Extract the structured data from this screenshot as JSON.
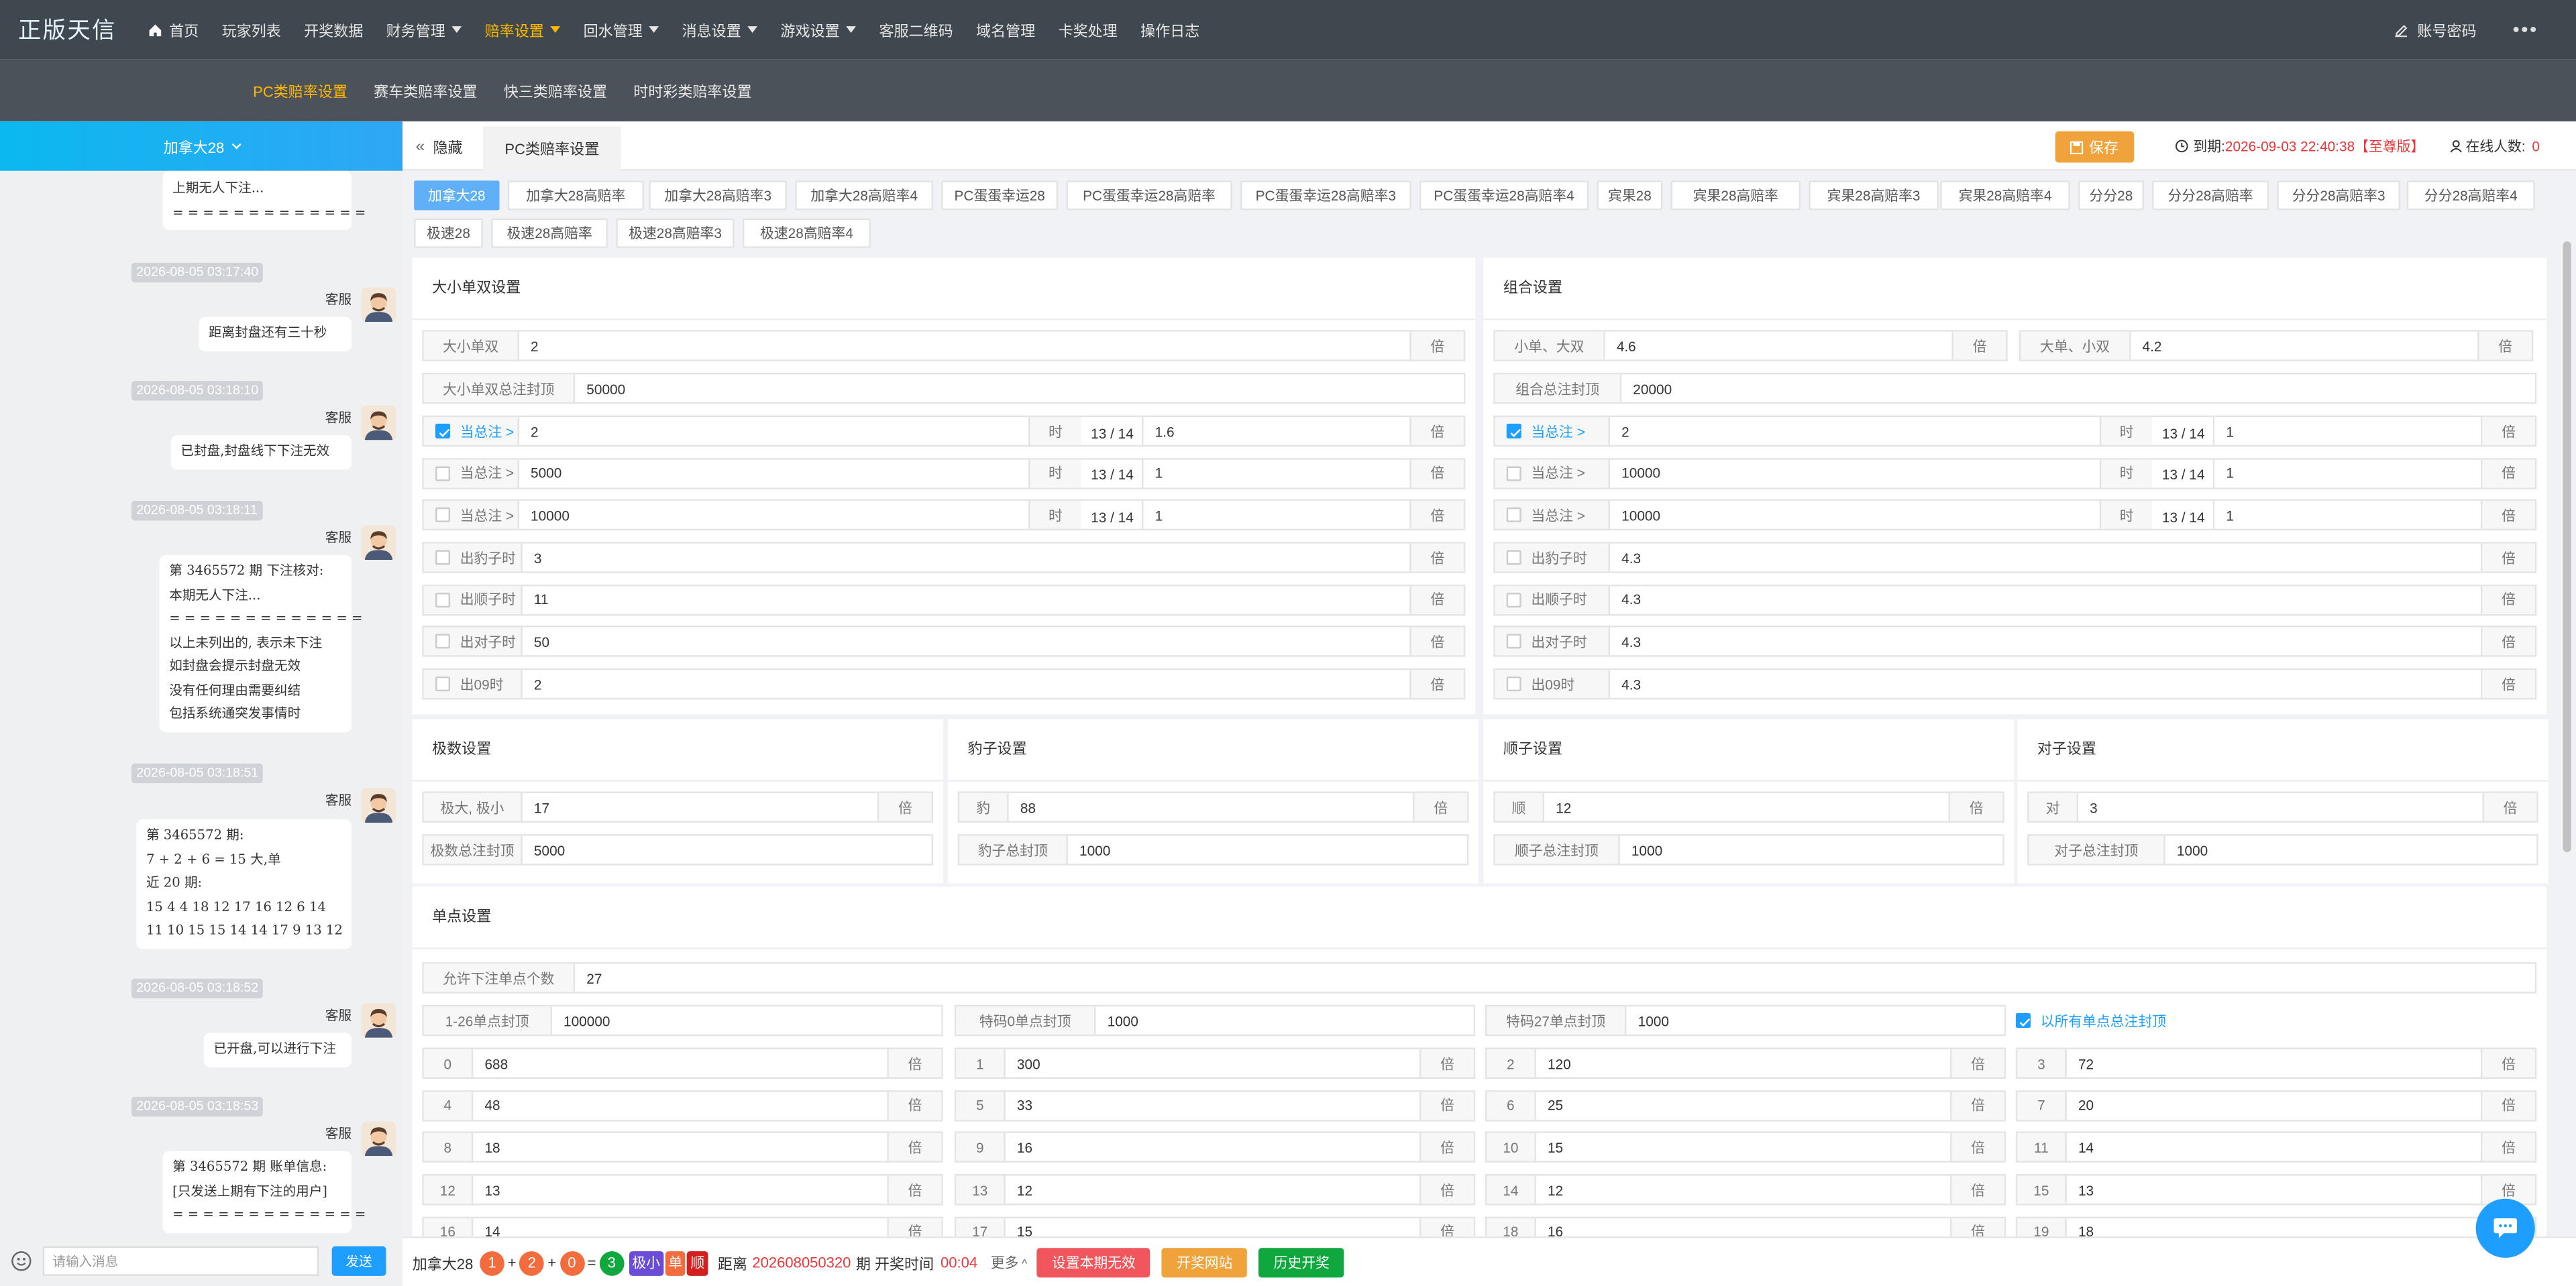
{
  "brand": "正版天信",
  "nav": [
    {
      "label": "首页",
      "icon": "home-icon"
    },
    {
      "label": "玩家列表"
    },
    {
      "label": "开奖数据"
    },
    {
      "label": "财务管理",
      "caret": true
    },
    {
      "label": "赔率设置",
      "caret": true,
      "active": true
    },
    {
      "label": "回水管理",
      "caret": true
    },
    {
      "label": "消息设置",
      "caret": true
    },
    {
      "label": "游戏设置",
      "caret": true
    },
    {
      "label": "客服二维码"
    },
    {
      "label": "域名管理"
    },
    {
      "label": "卡奖处理"
    },
    {
      "label": "操作日志"
    }
  ],
  "account_label": "账号密码",
  "more_label": "•••",
  "subnav": [
    {
      "label": "PC类赔率设置",
      "active": true
    },
    {
      "label": "赛车类赔率设置"
    },
    {
      "label": "快三类赔率设置"
    },
    {
      "label": "时时彩类赔率设置"
    }
  ],
  "chat": {
    "room": "加拿大28",
    "first_bubble": "上期无人下注...\n= = = = = = = = = = = = =",
    "messages": [
      {
        "time": "2026-08-05 03:17:40",
        "user": "客服",
        "text": "距离封盘还有三十秒"
      },
      {
        "time": "2026-08-05 03:18:10",
        "user": "客服",
        "text": "已封盘,封盘线下下注无效"
      },
      {
        "time": "2026-08-05 03:18:11",
        "user": "客服",
        "text": "第 3465572 期 下注核对:\n本期无人下注...\n= = = = = = = = = = = = =\n以上未列出的, 表示未下注\n如封盘会提示封盘无效\n没有任何理由需要纠结\n包括系统通突发事情时"
      },
      {
        "time": "2026-08-05 03:18:51",
        "user": "客服",
        "text": "第 3465572 期:\n7 + 2 + 6 = 15 大,单\n近 20 期:\n15 4 4 18 12 17 16 12 6 14\n11 10 15 15 14 14 17 9 13 12"
      },
      {
        "time": "2026-08-05 03:18:52",
        "user": "客服",
        "text": "已开盘,可以进行下注"
      },
      {
        "time": "2026-08-05 03:18:53",
        "user": "客服",
        "text": "第 3465572 期 账单信息:\n[只发送上期有下注的用户]\n= = = = = = = = = = = = ="
      }
    ],
    "input_placeholder": "请输入消息",
    "send_label": "发送"
  },
  "header": {
    "hide_label": "隐藏",
    "tab_label": "PC类赔率设置",
    "save_label": "保存",
    "expire_label": "到期:",
    "expire_value": "2026-09-03 22:40:38",
    "tier": "【至尊版】",
    "online_label": "在线人数:",
    "online_value": "0"
  },
  "games": [
    "加拿大28",
    "加拿大28高赔率",
    "加拿大28高赔率3",
    "加拿大28高赔率4",
    "PC蛋蛋幸运28",
    "PC蛋蛋幸运28高赔率",
    "PC蛋蛋幸运28高赔率3",
    "PC蛋蛋幸运28高赔率4",
    "宾果28",
    "宾果28高赔率",
    "宾果28高赔率3",
    "宾果28高赔率4",
    "分分28",
    "分分28高赔率",
    "分分28高赔率3",
    "分分28高赔率4",
    "极速28",
    "极速28高赔率",
    "极速28高赔率3",
    "极速28高赔率4"
  ],
  "selected_game": "加拿大28",
  "unit": "倍",
  "when_label": "时",
  "ratio_label": "13 / 14",
  "dxds": {
    "title": "大小单双设置",
    "odds_label": "大小单双",
    "odds_value": "2",
    "cap_label": "大小单双总注封顶",
    "cap_value": "50000",
    "tiers": [
      {
        "label": "当总注 >",
        "value": "2",
        "rate": "1.6",
        "checked": true
      },
      {
        "label": "当总注 >",
        "value": "5000",
        "rate": "1",
        "checked": false
      },
      {
        "label": "当总注 >",
        "value": "10000",
        "rate": "1",
        "checked": false
      }
    ],
    "specials": [
      {
        "label": "出豹子时",
        "value": "3"
      },
      {
        "label": "出顺子时",
        "value": "11"
      },
      {
        "label": "出对子时",
        "value": "50"
      },
      {
        "label": "出09时",
        "value": "2"
      }
    ]
  },
  "combo": {
    "title": "组合设置",
    "a_label": "小单、大双",
    "a_value": "4.6",
    "b_label": "大单、小双",
    "b_value": "4.2",
    "cap_label": "组合总注封顶",
    "cap_value": "20000",
    "tiers": [
      {
        "label": "当总注 >",
        "value": "2",
        "rate": "1",
        "checked": true
      },
      {
        "label": "当总注 >",
        "value": "10000",
        "rate": "1",
        "checked": false
      },
      {
        "label": "当总注 >",
        "value": "10000",
        "rate": "1",
        "checked": false
      }
    ],
    "specials": [
      {
        "label": "出豹子时",
        "value": "4.3"
      },
      {
        "label": "出顺子时",
        "value": "4.3"
      },
      {
        "label": "出对子时",
        "value": "4.3"
      },
      {
        "label": "出09时",
        "value": "4.3"
      }
    ]
  },
  "extreme": {
    "title": "极数设置",
    "odds_label": "极大, 极小",
    "odds_value": "17",
    "cap_label": "极数总注封顶",
    "cap_value": "5000"
  },
  "leopard": {
    "title": "豹子设置",
    "odds_label": "豹",
    "odds_value": "88",
    "cap_label": "豹子总封顶",
    "cap_value": "1000"
  },
  "straight": {
    "title": "顺子设置",
    "odds_label": "顺",
    "odds_value": "12",
    "cap_label": "顺子总注封顶",
    "cap_value": "1000"
  },
  "pair": {
    "title": "对子设置",
    "odds_label": "对",
    "odds_value": "3",
    "cap_label": "对子总注封顶",
    "cap_value": "1000"
  },
  "single": {
    "title": "单点设置",
    "count_label": "允许下注单点个数",
    "count_value": "27",
    "cap1_label": "1-26单点封顶",
    "cap1_value": "100000",
    "cap0_label": "特码0单点封顶",
    "cap0_value": "1000",
    "cap27_label": "特码27单点封顶",
    "cap27_value": "1000",
    "all_cap_label": "以所有单点总注封顶",
    "points": [
      {
        "n": "0",
        "v": "688"
      },
      {
        "n": "1",
        "v": "300"
      },
      {
        "n": "2",
        "v": "120"
      },
      {
        "n": "3",
        "v": "72"
      },
      {
        "n": "4",
        "v": "48"
      },
      {
        "n": "5",
        "v": "33"
      },
      {
        "n": "6",
        "v": "25"
      },
      {
        "n": "7",
        "v": "20"
      },
      {
        "n": "8",
        "v": "18"
      },
      {
        "n": "9",
        "v": "16"
      },
      {
        "n": "10",
        "v": "15"
      },
      {
        "n": "11",
        "v": "14"
      },
      {
        "n": "12",
        "v": "13"
      },
      {
        "n": "13",
        "v": "12"
      },
      {
        "n": "14",
        "v": "12"
      },
      {
        "n": "15",
        "v": "13"
      },
      {
        "n": "16",
        "v": "14"
      },
      {
        "n": "17",
        "v": "15"
      },
      {
        "n": "18",
        "v": "16"
      },
      {
        "n": "19",
        "v": "18"
      }
    ]
  },
  "footer": {
    "game": "加拿大28",
    "balls": [
      "1",
      "2",
      "0"
    ],
    "plus": "+",
    "eq": "=",
    "sum": "3",
    "tags": [
      {
        "text": "极小",
        "color": "#6a4cd6"
      },
      {
        "text": "单",
        "color": "#f36c3d"
      },
      {
        "text": "顺",
        "color": "#d3201f"
      }
    ],
    "dist_label": "距离",
    "issue": "202608050320",
    "issue_suffix": "期 开奖时间",
    "countdown": "00:04",
    "more_label": "更多",
    "btn_void": "设置本期无效",
    "btn_site": "开奖网站",
    "btn_history": "历史开奖"
  },
  "colors": {
    "accent": "#1e9fff",
    "active_nav": "#ffb800",
    "danger": "#e4393c",
    "save": "#f0a23b",
    "green": "#10a83e"
  }
}
